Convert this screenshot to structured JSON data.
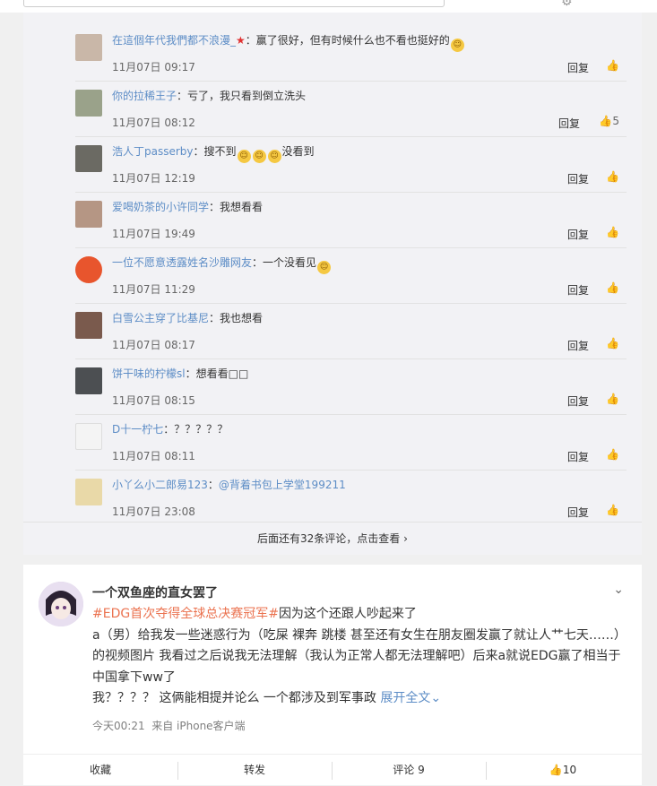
{
  "comments": [
    {
      "user": "在這個年代我們都不浪漫_",
      "sep": "：",
      "text": "赢了很好，但有时候什么也不看也挺好的",
      "time": "11月07日 09:17",
      "reply": "回复",
      "likes": ""
    },
    {
      "user": "你的拉稀王子",
      "sep": "：",
      "text": "亏了，我只看到倒立洗头",
      "time": "11月07日 08:12",
      "reply": "回复",
      "likes": "5"
    },
    {
      "user": "浩人丁passerby",
      "sep": "：",
      "text": "搜不到",
      "text2": "没看到",
      "time": "11月07日 12:19",
      "reply": "回复",
      "likes": ""
    },
    {
      "user": "爱喝奶茶的小许同学",
      "sep": "：",
      "text": "我想看看",
      "time": "11月07日 19:49",
      "reply": "回复",
      "likes": ""
    },
    {
      "user": "一位不愿意透露姓名沙雕网友",
      "sep": "：",
      "text": "一个没看见",
      "time": "11月07日 11:29",
      "reply": "回复",
      "likes": ""
    },
    {
      "user": "白雪公主穿了比基尼",
      "sep": "：",
      "text": "我也想看",
      "time": "11月07日 08:17",
      "reply": "回复",
      "likes": ""
    },
    {
      "user": "饼干味的柠檬sl",
      "sep": "：",
      "text": "想看看□□",
      "time": "11月07日 08:15",
      "reply": "回复",
      "likes": ""
    },
    {
      "user": "D十一柠七",
      "sep": "：",
      "text": "？？？？？",
      "time": "11月07日 08:11",
      "reply": "回复",
      "likes": ""
    },
    {
      "user": "小丫么小二郎易123",
      "sep": "：",
      "text": "@背着书包上学堂199211",
      "time": "11月07日 23:08",
      "reply": "回复",
      "likes": ""
    }
  ],
  "more_comments": "后面还有32条评论，点击查看",
  "post": {
    "author": "一个双鱼座的直女罢了",
    "hashtag": "#EDG首次夺得全球总决赛冠军#",
    "line1_rest": "因为这个还跟人吵起来了",
    "line2": "a（男）给我发一些迷惑行为（吃屎 裸奔 跳楼 甚至还有女生在朋友圈发赢了就让人艹七天……）",
    "line3": "的视频图片 我看过之后说我无法理解（我认为正常人都无法理解吧）后来a就说EDG赢了相当于",
    "line4": "中国拿下ww了",
    "line5": "我？？？？ 这俩能相提并论么 一个都涉及到军事政",
    "expand": "展开全文",
    "time": "今天00:21",
    "source": "来自 iPhone客户端"
  },
  "actions": {
    "favorite": "收藏",
    "repost": "转发",
    "comment": "评论 9",
    "like_count": "10"
  }
}
